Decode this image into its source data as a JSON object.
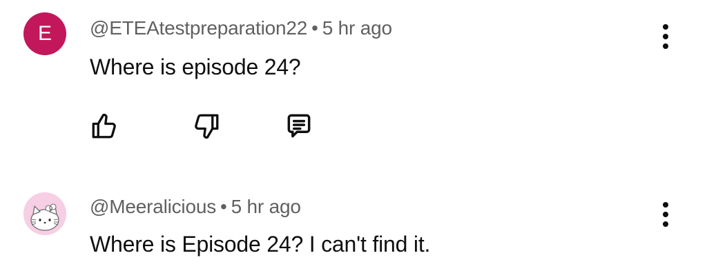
{
  "comments": [
    {
      "avatar_letter": "E",
      "avatar_color": "#c2185b",
      "author": "@ETEAtestpreparation22",
      "separator": "•",
      "time": "5 hr ago",
      "text": "Where is episode 24?",
      "actions": [
        "thumbs-up-icon",
        "thumbs-down-icon",
        "reply-icon"
      ],
      "menu_icon": "more-vert-icon"
    },
    {
      "avatar_image": "hello-kitty-avatar",
      "avatar_color": "#f6cfe4",
      "author": "@Meeralicious",
      "separator": "•",
      "time": "5 hr ago",
      "text": "Where is Episode 24? I can't find it.",
      "menu_icon": "more-vert-icon"
    }
  ]
}
